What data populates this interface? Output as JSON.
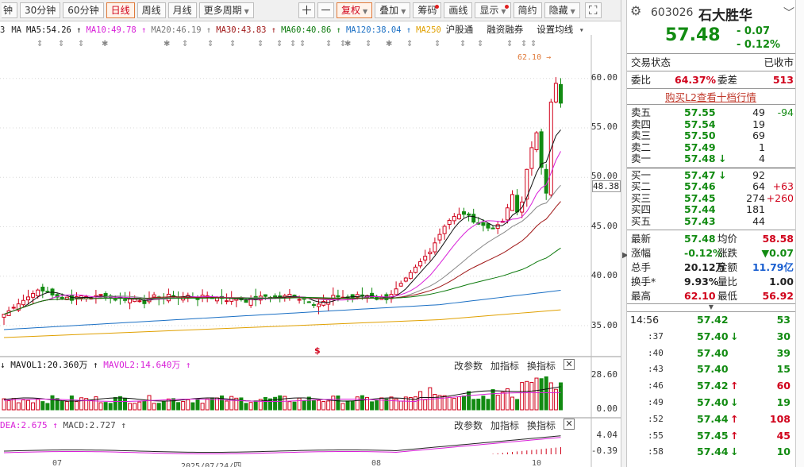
{
  "toolbar": {
    "left_buttons": [
      "钟",
      "30分钟",
      "60分钟",
      "日线",
      "周线",
      "月线",
      "更多周期"
    ],
    "active": "日线",
    "right_buttons": [
      {
        "label": "＋",
        "icon": true
      },
      {
        "label": "－",
        "icon": true
      },
      {
        "label": "复权",
        "dropdown": true,
        "active": true
      },
      {
        "label": "叠加",
        "dropdown": true
      },
      {
        "label": "筹码",
        "dot": true
      },
      {
        "label": "画线"
      },
      {
        "label": "显示",
        "dot": true,
        "dropdown": true
      },
      {
        "label": "简约"
      },
      {
        "label": "隐藏",
        "dropdown": true
      },
      {
        "label": "⛶",
        "icon": true
      }
    ]
  },
  "ma_legend": [
    {
      "text": "3",
      "color": "#222222"
    },
    {
      "text": "MA",
      "color": "#222222"
    },
    {
      "text": "MA5:54.26 ↑",
      "color": "#111111"
    },
    {
      "text": "MA10:49.78 ↑",
      "color": "#d81fd8"
    },
    {
      "text": "MA20:46.19 ↑",
      "color": "#777777"
    },
    {
      "text": "MA30:43.83 ↑",
      "color": "#a01818"
    },
    {
      "text": "MA60:40.86 ↑",
      "color": "#0d7a0d"
    },
    {
      "text": "MA120:38.04 ↑",
      "color": "#1a6fc4"
    },
    {
      "text": "MA250",
      "color": "#e0a000"
    }
  ],
  "ma_extra": [
    "沪股通",
    "融资融券",
    "设置均线"
  ],
  "price_axis": [
    "60.00",
    "55.00",
    "50.00",
    "45.00",
    "40.00",
    "35.00"
  ],
  "current_price_tag": "48.38",
  "high_annotation": "62.10",
  "vol_panel": {
    "title_vol1": "↓ MAVOL1:20.360万 ↑",
    "title_vol2": "MAVOL2:14.640万 ↑",
    "axis_top": "28.60",
    "axis_bottom": "0.00",
    "buttons": [
      "改参数",
      "加指标",
      "换指标"
    ],
    "close": "✕"
  },
  "macd_panel": {
    "title_dea": "DEA:2.675 ↑",
    "title_macd": "MACD:2.727 ↑",
    "axis_top": "4.04",
    "axis_bottom": "-0.39",
    "buttons": [
      "改参数",
      "加指标",
      "换指标"
    ],
    "close": "✕"
  },
  "date_axis": [
    "07",
    "2025/07/24/四",
    "08",
    "10"
  ],
  "stock": {
    "code": "603026",
    "name": "石大胜华",
    "price": "57.48",
    "change": "- 0.07",
    "change_pct": "- 0.12%"
  },
  "status": {
    "label": "交易状态",
    "value": "已收市"
  },
  "weibi": {
    "label": "委比",
    "value": "64.37%",
    "cha_label": "委差",
    "cha_value": "513"
  },
  "l2_link": "购买L2查看十档行情",
  "asks": [
    {
      "label": "卖五",
      "price": "57.55",
      "vol": "49",
      "delta": "-94"
    },
    {
      "label": "卖四",
      "price": "57.54",
      "vol": "19",
      "delta": ""
    },
    {
      "label": "卖三",
      "price": "57.50",
      "vol": "69",
      "delta": ""
    },
    {
      "label": "卖二",
      "price": "57.49",
      "vol": "1",
      "delta": ""
    },
    {
      "label": "卖一",
      "price": "57.48",
      "arrow": "down",
      "vol": "4",
      "delta": ""
    }
  ],
  "bids": [
    {
      "label": "买一",
      "price": "57.47",
      "arrow": "down",
      "vol": "92",
      "delta": ""
    },
    {
      "label": "买二",
      "price": "57.46",
      "vol": "64",
      "delta": "+63"
    },
    {
      "label": "买三",
      "price": "57.45",
      "vol": "274",
      "delta": "+260"
    },
    {
      "label": "买四",
      "price": "57.44",
      "vol": "181",
      "delta": ""
    },
    {
      "label": "买五",
      "price": "57.43",
      "vol": "44",
      "delta": ""
    }
  ],
  "stats": [
    {
      "l1": "最新",
      "v1": "57.48",
      "c1": "green",
      "l2": "均价",
      "v2": "58.58",
      "c2": "red"
    },
    {
      "l1": "涨幅",
      "v1": "-0.12%",
      "c1": "green",
      "l2": "涨跌",
      "v2": "▼0.07",
      "c2": "green"
    },
    {
      "l1": "总手",
      "v1": "20.12万",
      "c1": "black",
      "l2": "金额",
      "v2": "11.79亿",
      "c2": "blue"
    },
    {
      "l1": "换手*",
      "v1": "9.93%",
      "c1": "black",
      "l2": "量比",
      "v2": "1.00",
      "c2": "black"
    },
    {
      "l1": "最高",
      "v1": "62.10",
      "c1": "red",
      "l2": "最低",
      "v2": "56.92",
      "c2": "red"
    }
  ],
  "ticks": [
    {
      "time": "14:56",
      "price": "57.42",
      "arrow": "",
      "vol": "53",
      "vc": "green"
    },
    {
      "time": ":37",
      "price": "57.40",
      "arrow": "down",
      "vol": "30",
      "vc": "green"
    },
    {
      "time": ":40",
      "price": "57.40",
      "arrow": "",
      "vol": "39",
      "vc": "green"
    },
    {
      "time": ":43",
      "price": "57.40",
      "arrow": "",
      "vol": "15",
      "vc": "green"
    },
    {
      "time": ":46",
      "price": "57.42",
      "arrow": "up",
      "vol": "60",
      "vc": "red"
    },
    {
      "time": ":49",
      "price": "57.40",
      "arrow": "down",
      "vol": "19",
      "vc": "green"
    },
    {
      "time": ":52",
      "price": "57.44",
      "arrow": "up",
      "vol": "108",
      "vc": "red"
    },
    {
      "time": ":55",
      "price": "57.45",
      "arrow": "up",
      "vol": "45",
      "vc": "red"
    },
    {
      "time": ":58",
      "price": "57.44",
      "arrow": "down",
      "vol": "10",
      "vc": "green"
    }
  ],
  "colors": {
    "up": "#d0021b",
    "down": "#128b12",
    "accent": "#e07a3a"
  }
}
